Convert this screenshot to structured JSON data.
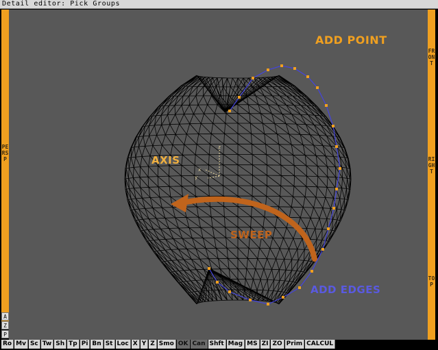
{
  "window": {
    "title": "Detail editor: Pick Groups"
  },
  "side_labels": {
    "left": "PERSP",
    "right_front": "FRONT",
    "right_right": "RIGHT",
    "right_top": "TOP"
  },
  "corner_buttons": [
    "A",
    "Z",
    "P"
  ],
  "annotations": {
    "add_point": "ADD POINT",
    "axis": "AXIS",
    "sweep": "SWEEP",
    "add_edges": "ADD EDGES"
  },
  "axis_gizmo": {
    "x": "x",
    "y": "y",
    "z": "z"
  },
  "colors": {
    "accent_orange": "#f0a020",
    "sweep_brown": "#c0641c",
    "edge_blue": "#4444dd",
    "viewport": "#585858",
    "button_gray": "#d8d8d8"
  },
  "toolbar": [
    {
      "label": "Ro",
      "state": "normal"
    },
    {
      "label": "Mv",
      "state": "normal"
    },
    {
      "label": "Sc",
      "state": "normal"
    },
    {
      "label": "Tw",
      "state": "normal"
    },
    {
      "label": "Sh",
      "state": "normal"
    },
    {
      "label": "Tp",
      "state": "normal"
    },
    {
      "label": "Pi",
      "state": "normal"
    },
    {
      "label": "Bn",
      "state": "normal"
    },
    {
      "label": "St",
      "state": "normal"
    },
    {
      "label": "Loc",
      "state": "normal"
    },
    {
      "label": "X",
      "state": "normal"
    },
    {
      "label": "Y",
      "state": "normal"
    },
    {
      "label": "Z",
      "state": "normal"
    },
    {
      "label": "Smo",
      "state": "normal"
    },
    {
      "label": "OK",
      "state": "dark"
    },
    {
      "label": "Can",
      "state": "dark"
    },
    {
      "label": "Shft",
      "state": "normal"
    },
    {
      "label": "Mag",
      "state": "normal"
    },
    {
      "label": "MS",
      "state": "normal"
    },
    {
      "label": "ZI",
      "state": "normal"
    },
    {
      "label": "ZO",
      "state": "normal"
    },
    {
      "label": "Prim",
      "state": "normal"
    },
    {
      "label": "CALCUL",
      "state": "normal"
    }
  ]
}
